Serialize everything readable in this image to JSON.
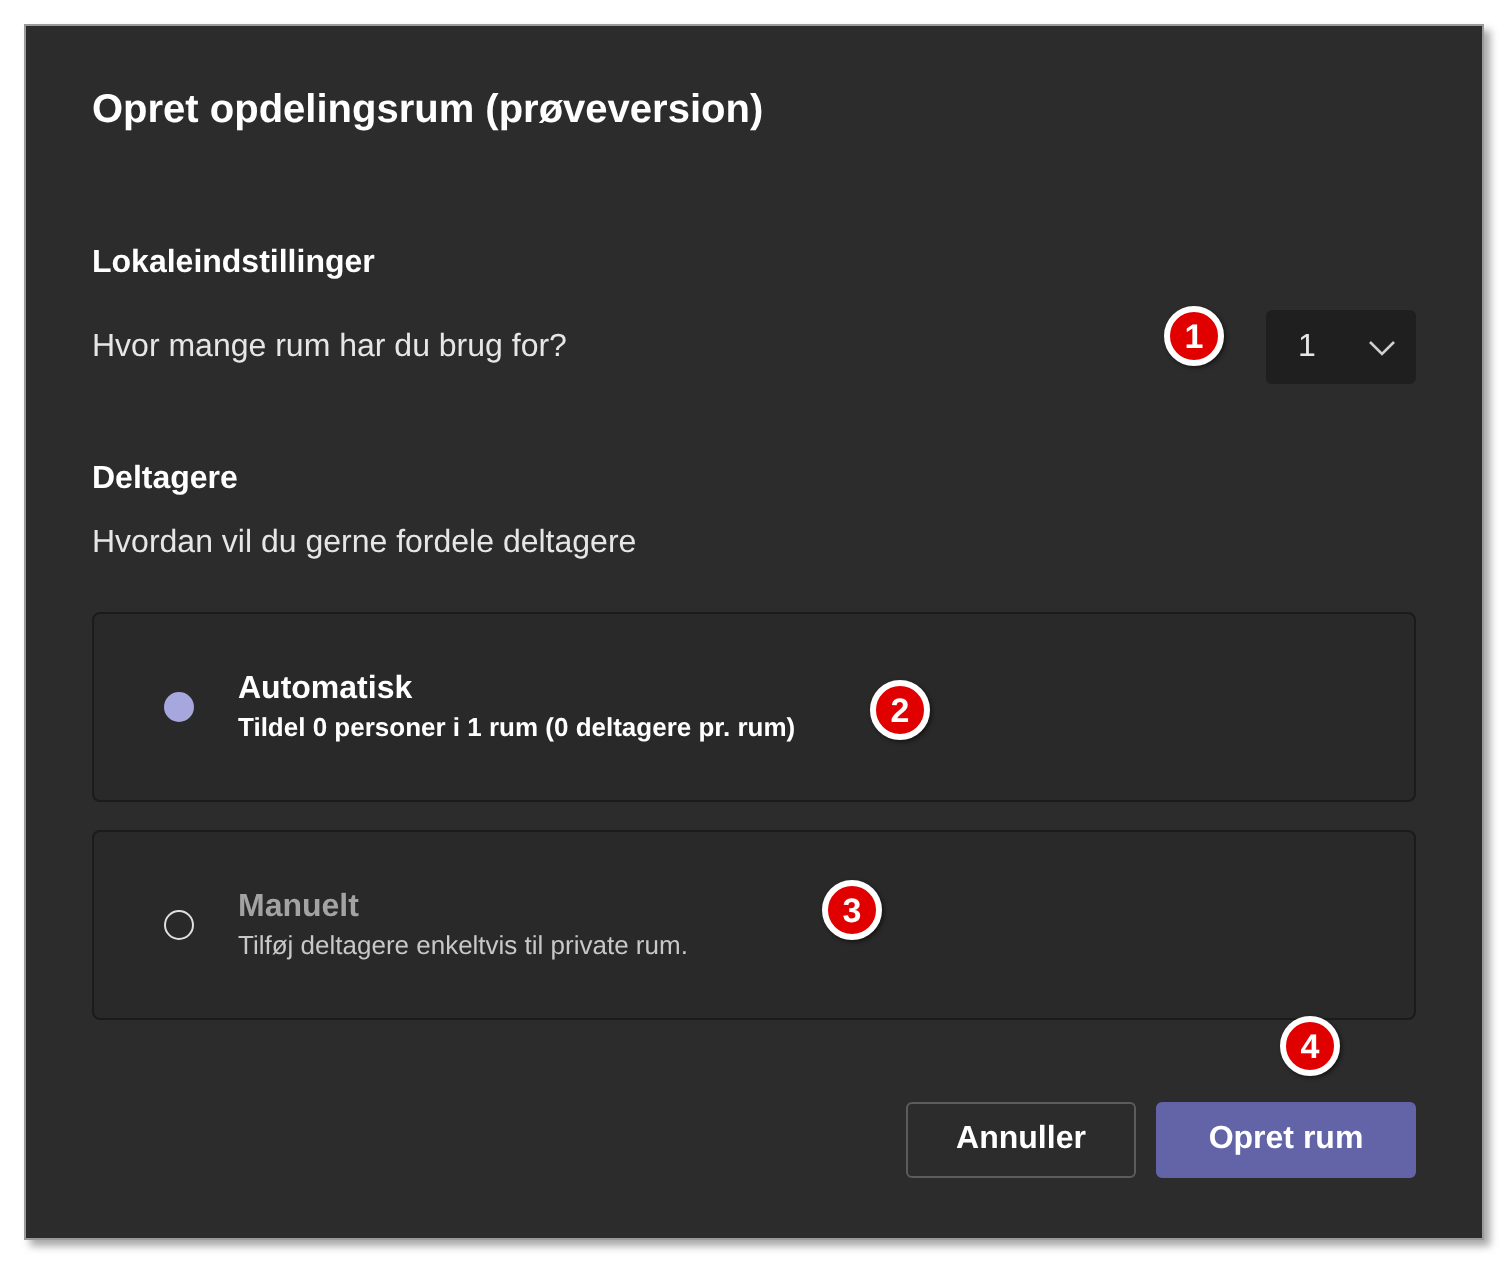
{
  "dialog": {
    "title": "Opret opdelingsrum (prøveversion)"
  },
  "room_settings": {
    "heading": "Lokaleindstillinger",
    "question": "Hvor mange rum har du brug for?",
    "room_count": {
      "value": "1"
    }
  },
  "participants": {
    "heading": "Deltagere",
    "question": "Hvordan vil du gerne fordele deltagere",
    "options": [
      {
        "title": "Automatisk",
        "description": "Tildel 0 personer i 1 rum (0 deltagere pr. rum)",
        "selected": true
      },
      {
        "title": "Manuelt",
        "description": "Tilføj deltagere enkeltvis til private rum.",
        "selected": false
      }
    ]
  },
  "buttons": [
    {
      "label": "Annuller",
      "kind": "secondary"
    },
    {
      "label": "Opret rum",
      "kind": "primary"
    }
  ],
  "annotations": [
    {
      "label": "1"
    },
    {
      "label": "2"
    },
    {
      "label": "3"
    },
    {
      "label": "4"
    }
  ]
}
